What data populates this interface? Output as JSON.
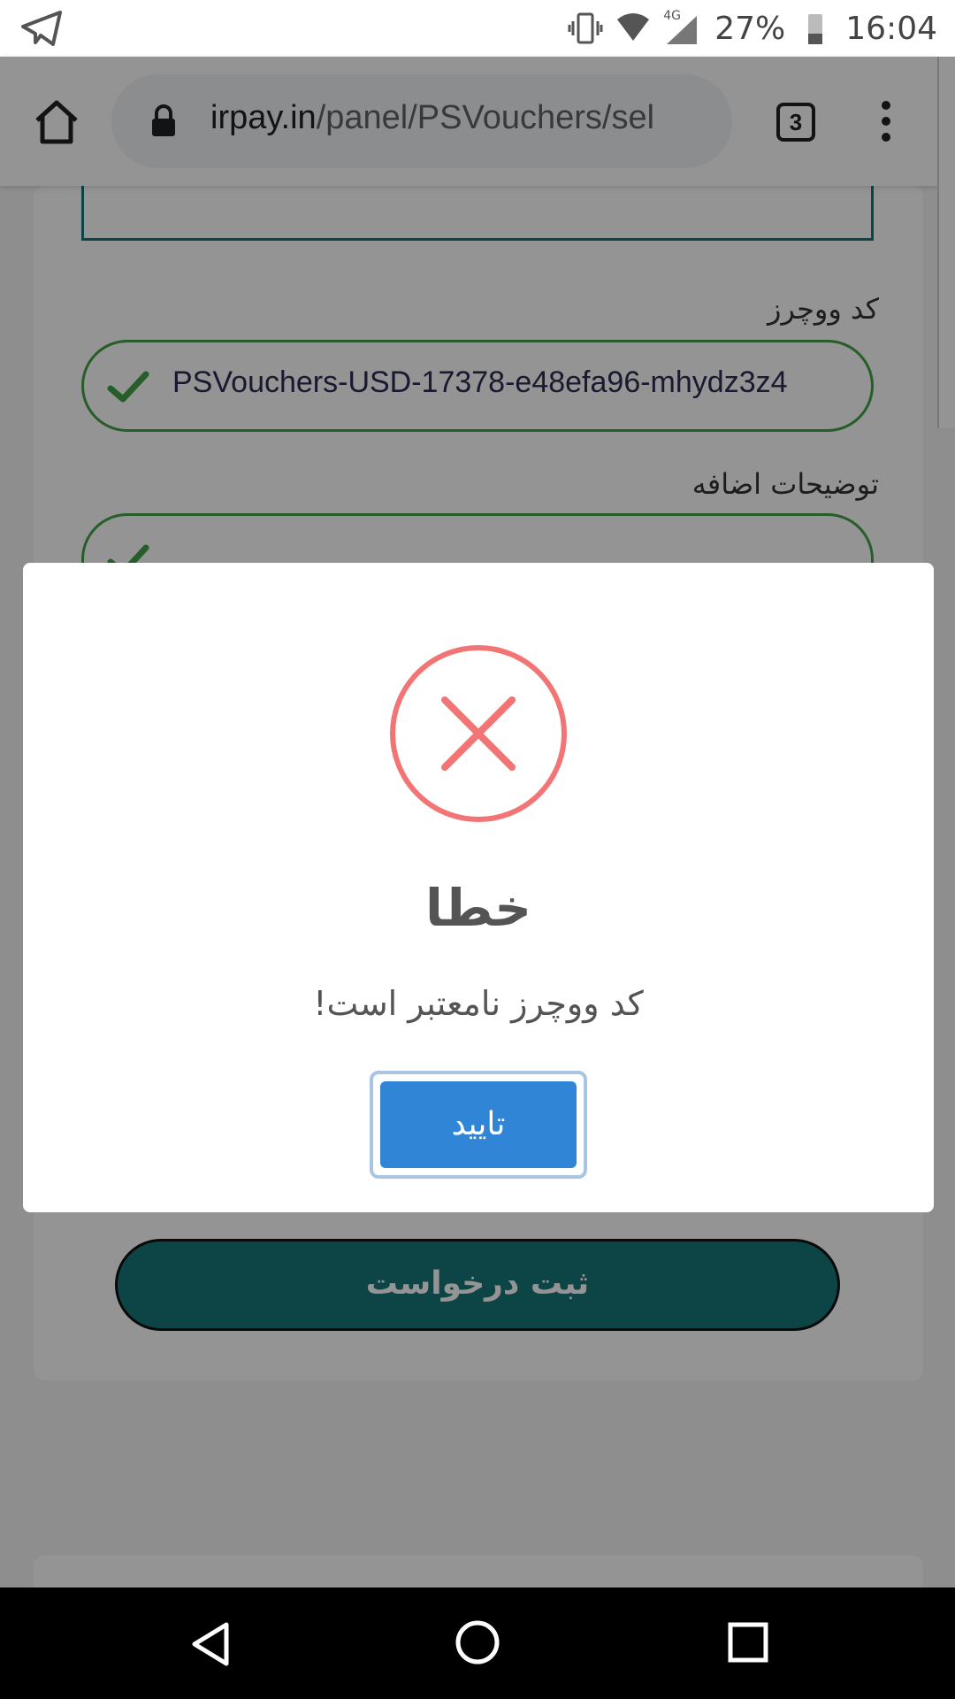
{
  "status_bar": {
    "battery": "27%",
    "time": "16:04",
    "network": "4G"
  },
  "browser": {
    "url_host": "irpay.in",
    "url_path": "/panel/PSVouchers/sel",
    "tab_count": "3"
  },
  "form": {
    "voucher_label": "کد ووچرز",
    "voucher_value": "PSVouchers-USD-17378-e48efa96-mhydz3z4",
    "notes_label": "توضیحات اضافه",
    "submit_label": "ثبت درخواست"
  },
  "modal": {
    "title": "خطا",
    "message": "کد ووچرز نامعتبر است!",
    "ok_label": "تایید"
  },
  "colors": {
    "accent_teal": "#17777a",
    "success_green": "#43a047",
    "error_red": "#f27474",
    "confirm_blue": "#3085d6"
  }
}
